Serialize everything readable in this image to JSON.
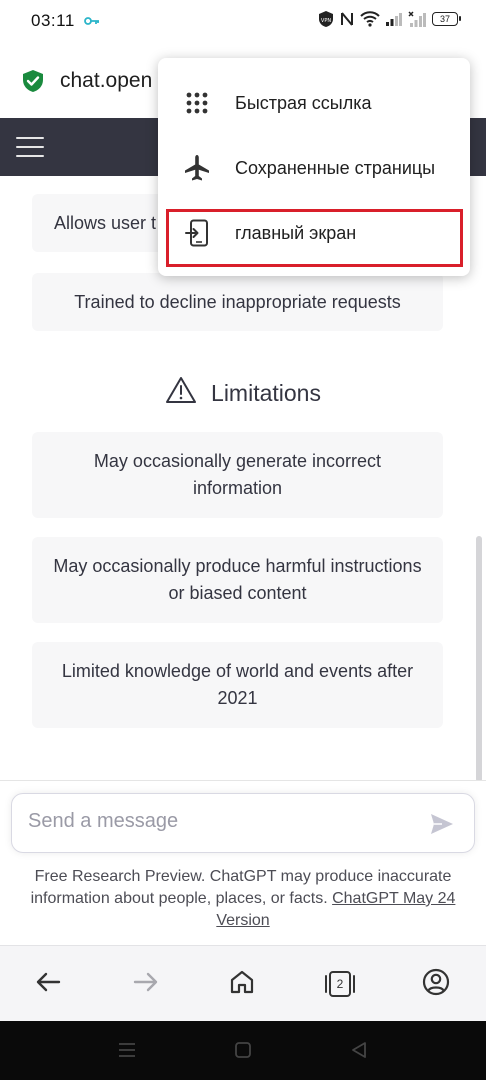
{
  "status_bar": {
    "time": "03:11",
    "battery": "37",
    "icons": [
      "key-icon",
      "vpn-icon",
      "nfc-icon",
      "wifi-icon",
      "signal-icon",
      "signal-off-icon",
      "battery-icon"
    ]
  },
  "browser": {
    "url": "chat.open",
    "tabs_count": "2"
  },
  "menu": {
    "items": [
      {
        "label": "Быстрая ссылка",
        "icon": "grid-dots-icon"
      },
      {
        "label": "Сохраненные страницы",
        "icon": "airplane-icon"
      },
      {
        "label": "главный экран",
        "icon": "add-to-home-icon"
      }
    ],
    "highlight_color": "#d91f2a"
  },
  "content": {
    "card_partial": "Allows user t",
    "card_capabilities_last": "Trained to decline inappropriate requests",
    "limitations_heading": "Limitations",
    "limitations": [
      "May occasionally generate incorrect information",
      "May occasionally produce harmful instructions or biased content",
      "Limited knowledge of world and events after 2021"
    ]
  },
  "input": {
    "placeholder": "Send a message",
    "disclaimer": "Free Research Preview. ChatGPT may produce inaccurate information about people, places, or facts.",
    "version_link": "ChatGPT May 24 Version"
  },
  "colors": {
    "header_bg": "#343541",
    "card_bg": "#f7f7f8",
    "shield_green": "#1a8a3e"
  }
}
